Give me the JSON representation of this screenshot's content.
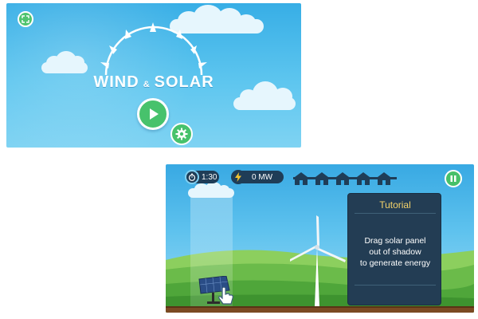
{
  "title_screen": {
    "title_left": "WIND",
    "title_amp": "&",
    "title_right": "SOLAR",
    "buttons": {
      "fullscreen_icon": "expand-icon",
      "play_icon": "play-icon",
      "settings_icon": "gear-icon"
    }
  },
  "game_screen": {
    "hud": {
      "timer": "1:30",
      "timer_icon": "stopwatch-icon",
      "energy": "0 MW",
      "energy_icon": "lightning-icon",
      "houses_count": 5,
      "house_icon": "house-icon",
      "pause_icon": "pause-icon"
    },
    "tutorial": {
      "title": "Tutorial",
      "lines": [
        "Drag solar panel",
        "out of shadow",
        "to generate energy"
      ]
    },
    "objects": {
      "solar_panel": "solar-panel",
      "wind_turbine": "wind-turbine",
      "hand_cursor": "hand-pointer-icon"
    }
  },
  "colors": {
    "sky": "#4bb8ea",
    "button_green": "#47c26c",
    "panel_bg": "#233d54",
    "panel_title": "#f4d36a",
    "hill_green": "#6bbb4a",
    "ground_brown": "#7b4a23"
  }
}
